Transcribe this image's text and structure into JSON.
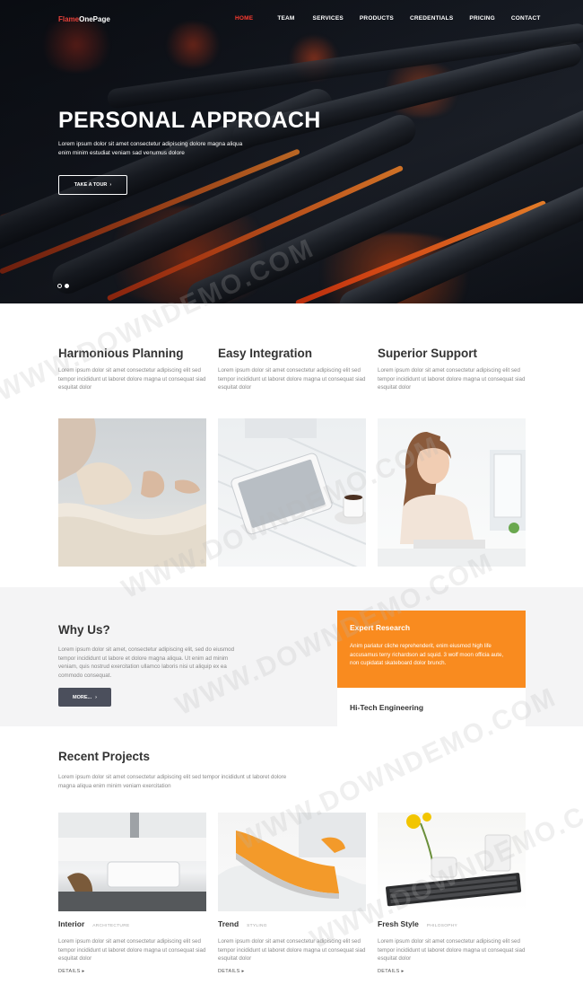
{
  "nav": {
    "logo_part1": "Flame",
    "logo_part2": "OnePage",
    "items": [
      {
        "label": "HOME",
        "active": true
      },
      {
        "label": "TEAM"
      },
      {
        "label": "SERVICES"
      },
      {
        "label": "PRODUCTS"
      },
      {
        "label": "CREDENTIALS"
      },
      {
        "label": "PRICING"
      },
      {
        "label": "CONTACT"
      }
    ]
  },
  "hero": {
    "title": "PERSONAL APPROACH",
    "text_line1": "Lorem ipsum dolor sit amet consectetur adipiscing dolore magna aliqua",
    "text_line2": "enim minim estudiat veniam sad venumus dolore",
    "button_label": "TAKE A TOUR",
    "button_icon": "chevron-right-icon",
    "slides": 2,
    "active_slide": 2
  },
  "features": [
    {
      "title": "Harmonious Planning",
      "text": "Lorem ipsum dolor sit amet consectetur adipiscing elit sed tempor incididunt ut laboret dolore magna ut consequat siad esquitat dolor",
      "photo": "meditation-photo"
    },
    {
      "title": "Easy Integration",
      "text": "Lorem ipsum dolor sit amet consectetur adipiscing elit sed tempor incididunt ut laboret dolore magna ut consequat siad esquitat dolor",
      "photo": "tablet-desk-photo"
    },
    {
      "title": "Superior Support",
      "text": "Lorem ipsum dolor sit amet consectetur adipiscing elit sed tempor incididunt ut laboret dolore magna ut consequat siad esquitat dolor",
      "photo": "support-woman-photo"
    }
  ],
  "why": {
    "title": "Why Us?",
    "text": "Lorem ipsum dolor sit amet, consectetur adipiscing elit, sed do eiusmod tempor incididunt ut labore et dolore magna aliqua. Ut enim ad minim veniam, quis nostrud exercitation ullamco laboris nisi ut aliquip ex ea commodo consequat.",
    "button_label": "MORE...",
    "accordion": [
      {
        "title": "Expert Research",
        "text": "Anim pariatur cliche reprehenderit, enim eiusmod high life accusamus terry richardson ad squid. 3 wolf moon officia aute, non cupidatat skateboard dolor brunch.",
        "open": true
      },
      {
        "title": "Hi-Tech Engineering",
        "open": false
      }
    ]
  },
  "projects": {
    "title": "Recent Projects",
    "text": "Lorem ipsum dolor sit amet consectetur adipiscing elit sed tempor incididunt ut laboret dolore magna aliqua enim minim veniam exercitation",
    "items": [
      {
        "name": "Interior",
        "category": "ARCHITECTURE",
        "text": "Lorem ipsum dolor sit amet consectetur adipiscing elit sed tempor incididunt ut laboret dolore magna ut consequat siad esquitat dolor",
        "details": "DETAILS"
      },
      {
        "name": "Trend",
        "category": "STYLING",
        "text": "Lorem ipsum dolor sit amet consectetur adipiscing elit sed tempor incididunt ut laboret dolore magna ut consequat siad esquitat dolor",
        "details": "DETAILS"
      },
      {
        "name": "Fresh Style",
        "category": "PHILOSOPHY",
        "text": "Lorem ipsum dolor sit amet consectetur adipiscing elit sed tempor incididunt ut laboret dolore magna ut consequat siad esquitat dolor",
        "details": "DETAILS"
      }
    ]
  },
  "watermark": "WWW.DOWNDEMO.COM",
  "colors": {
    "accent": "#f98b1f",
    "nav_active": "#ff3b30",
    "logo_red": "#e8423b",
    "dark_button": "#4b4f5c"
  }
}
